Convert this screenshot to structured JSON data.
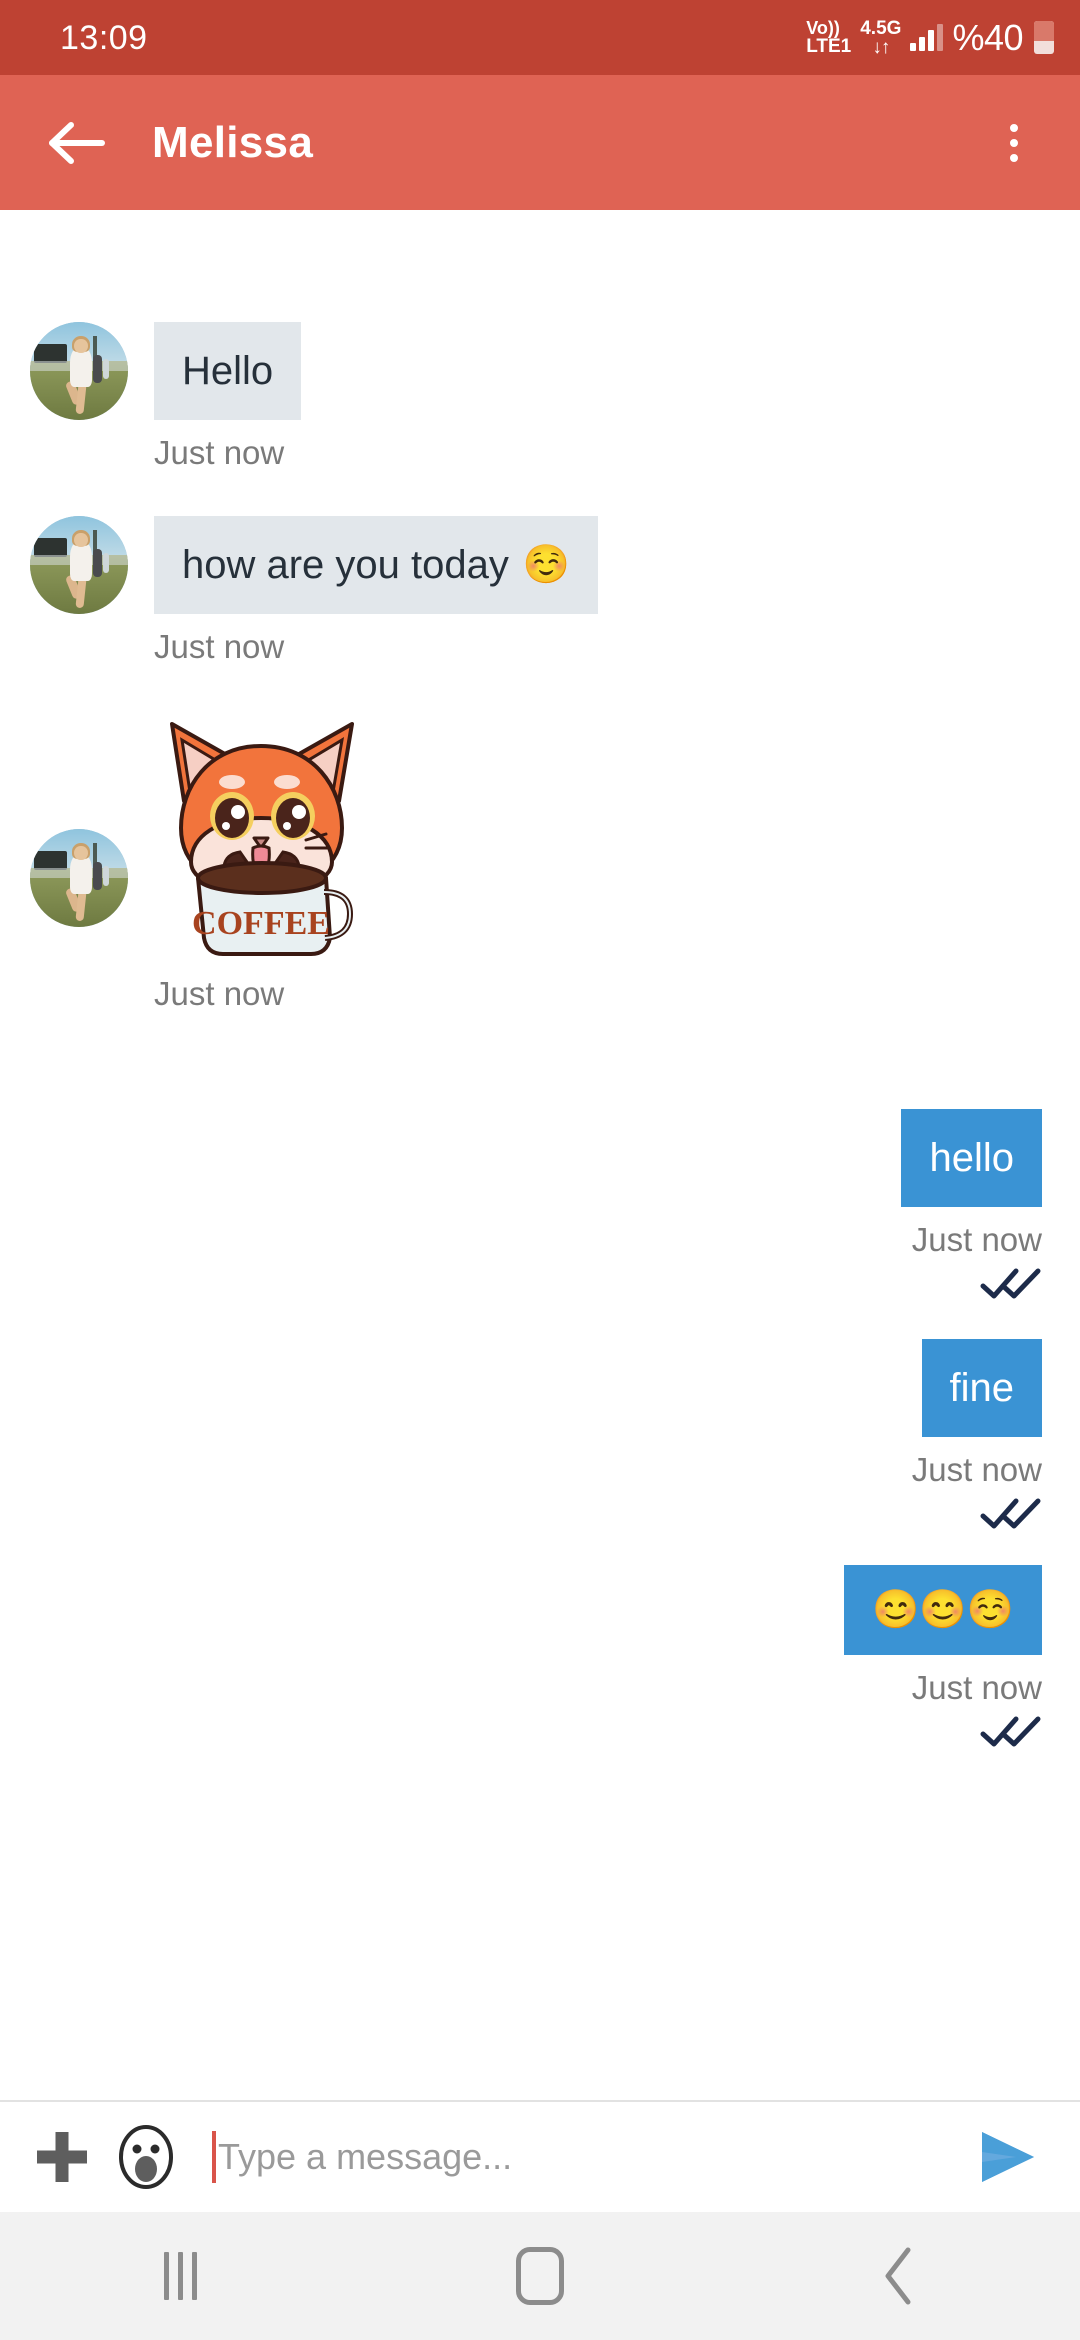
{
  "status_bar": {
    "clock": "13:09",
    "volte_line1": "Vo))",
    "volte_line2": "LTE1",
    "network_line1": "4.5G",
    "network_line2": "↓↑",
    "battery_text": "%40",
    "signal_icon": "signal-bars-icon",
    "battery_icon": "battery-icon"
  },
  "app_bar": {
    "back_icon": "back-arrow-icon",
    "title": "Melissa",
    "overflow_icon": "overflow-menu-icon"
  },
  "conversation": {
    "messages": [
      {
        "id": "m1",
        "direction": "incoming",
        "kind": "text",
        "text": "Hello",
        "emoji": "",
        "time": "Just now",
        "avatar": "contact-avatar"
      },
      {
        "id": "m2",
        "direction": "incoming",
        "kind": "text",
        "text": "how are you today",
        "emoji": "☺️",
        "time": "Just now",
        "avatar": "contact-avatar"
      },
      {
        "id": "m3",
        "direction": "incoming",
        "kind": "sticker",
        "text": "",
        "sticker_name": "fox-coffee-sticker",
        "sticker_label": "COFFEE",
        "time": "Just now",
        "avatar": "contact-avatar"
      },
      {
        "id": "m4",
        "direction": "outgoing",
        "kind": "text",
        "text": "hello",
        "emoji": "",
        "time": "Just now",
        "read_status": "read",
        "read_icon": "double-check-icon"
      },
      {
        "id": "m5",
        "direction": "outgoing",
        "kind": "text",
        "text": "fine",
        "emoji": "",
        "time": "Just now",
        "read_status": "read",
        "read_icon": "double-check-icon"
      },
      {
        "id": "m6",
        "direction": "outgoing",
        "kind": "text",
        "text": "",
        "emoji": "😊😊☺️",
        "time": "Just now",
        "read_status": "read",
        "read_icon": "double-check-icon"
      }
    ]
  },
  "composer": {
    "attach_icon": "plus-icon",
    "emoji_icon": "emoji-face-icon",
    "placeholder": "Type a message...",
    "value": "",
    "send_icon": "send-icon"
  },
  "nav_bar": {
    "recents_icon": "recents-icon",
    "home_icon": "home-icon",
    "back_icon": "nav-back-icon"
  },
  "colors": {
    "status_bar": "#be4233",
    "app_bar": "#df6354",
    "incoming_bubble": "#e2e7eb",
    "outgoing_bubble": "#3a93d4",
    "meta_text": "#7a7a7a",
    "send_accent": "#4a9fd8",
    "caret": "#d9544a",
    "nav_bar": "#f2f2f2"
  }
}
